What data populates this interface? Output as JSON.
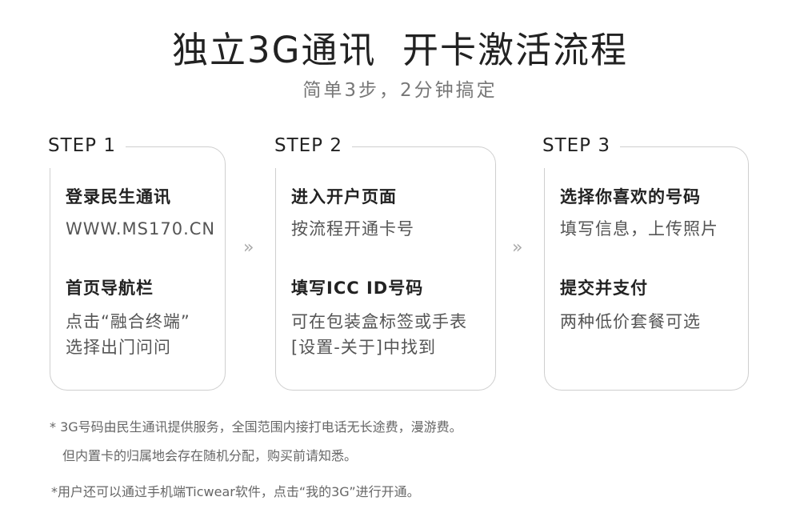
{
  "header": {
    "title": "独立3G通讯  开卡激活流程",
    "subtitle": "简单3步，2分钟搞定"
  },
  "steps": [
    {
      "label": "STEP 1",
      "items": [
        {
          "title": "登录民生通讯",
          "desc": [
            "WWW.MS170.CN"
          ]
        },
        {
          "title": "首页导航栏",
          "desc": [
            "点击“融合终端”",
            "选择出门问问"
          ]
        }
      ]
    },
    {
      "label": "STEP 2",
      "items": [
        {
          "title": "进入开户页面",
          "desc": [
            "按流程开通卡号"
          ]
        },
        {
          "title": "填写ICC ID号码",
          "desc": [
            "可在包装盒标签或手表",
            "[设置-关于]中找到"
          ]
        }
      ]
    },
    {
      "label": "STEP 3",
      "items": [
        {
          "title": "选择你喜欢的号码",
          "desc": [
            "填写信息，上传照片"
          ]
        },
        {
          "title": "提交并支付",
          "desc": [
            "两种低价套餐可选"
          ]
        }
      ]
    }
  ],
  "arrows": [
    "»",
    "»"
  ],
  "notes": [
    "*  3G号码由民生通讯提供服务，全国范围内接打电话无长途费，漫游费。",
    "但内置卡的归属地会存在随机分配，购买前请知悉。",
    "*用户还可以通过手机端Ticwear软件，点击“我的3G”进行开通。"
  ]
}
